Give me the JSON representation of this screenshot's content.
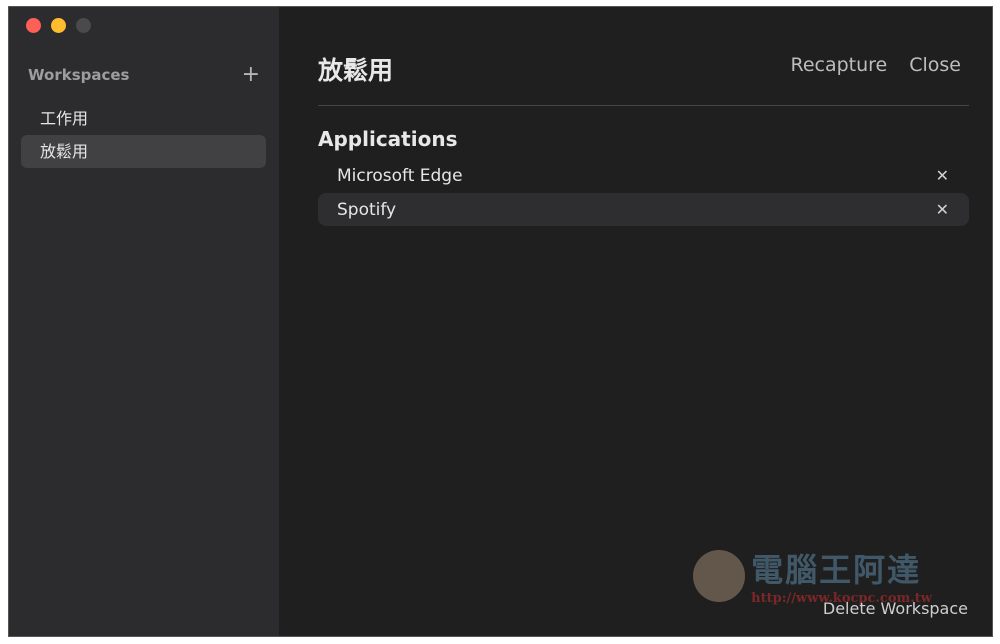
{
  "window": {
    "traffic_lights": {
      "close": "#fe5f57",
      "minimize": "#febc2e",
      "zoom": "#4a494b"
    }
  },
  "sidebar": {
    "title": "Workspaces",
    "add_icon": "+",
    "items": [
      {
        "label": "工作用"
      },
      {
        "label": "放鬆用"
      }
    ],
    "selected_index": 1
  },
  "main": {
    "title": "放鬆用",
    "recapture_label": "Recapture",
    "close_label": "Close",
    "section_title": "Applications",
    "apps": [
      {
        "name": "Microsoft Edge"
      },
      {
        "name": "Spotify"
      }
    ],
    "remove_icon": "✕",
    "delete_label": "Delete Workspace"
  },
  "watermark": {
    "name": "電腦王阿達",
    "url": "http://www.kocpc.com.tw"
  }
}
